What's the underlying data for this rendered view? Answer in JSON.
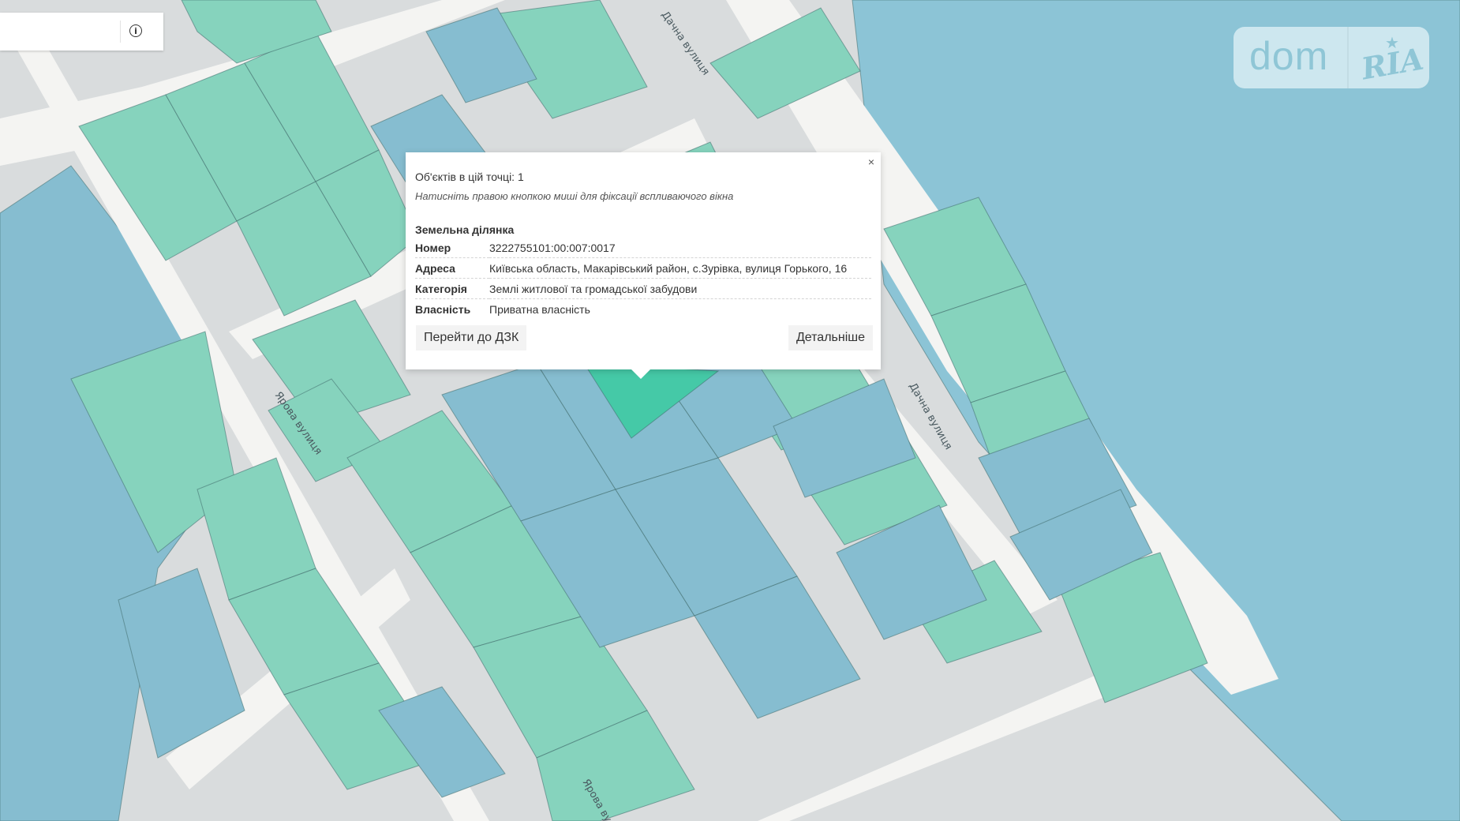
{
  "map": {
    "streets": [
      "Дачна вулиця",
      "Ярова вулиця",
      "Дачна вулиця",
      "Ярова вул"
    ],
    "colors": {
      "residential": "#86d3bd",
      "other": "#86bdd0",
      "selected": "#45c9a7",
      "road": "#f4f4f2",
      "background": "#d9dcdd"
    }
  },
  "toolbar": {
    "info_icon": "info-icon",
    "info_symbol": "i"
  },
  "logo": {
    "dom": "dom",
    "ria": "RIA",
    "star": "★"
  },
  "popup": {
    "close": "×",
    "objects_count": "Об'єктів в цій точці: 1",
    "hint": "Натисніть правою кнопкою миші для фіксації вспливаючого вікна",
    "section_title": "Земельна ділянка",
    "rows": [
      {
        "key": "Номер",
        "value": "3222755101:00:007:0017"
      },
      {
        "key": "Адреса",
        "value": "Київська область, Макарівський район, с.Зурівка, вулиця Горького, 16"
      },
      {
        "key": "Категорія",
        "value": "Землі житлової та громадської забудови"
      },
      {
        "key": "Власність",
        "value": "Приватна власність"
      }
    ],
    "go_to_button": "Перейти до ДЗК",
    "details_button": "Детальніше"
  }
}
